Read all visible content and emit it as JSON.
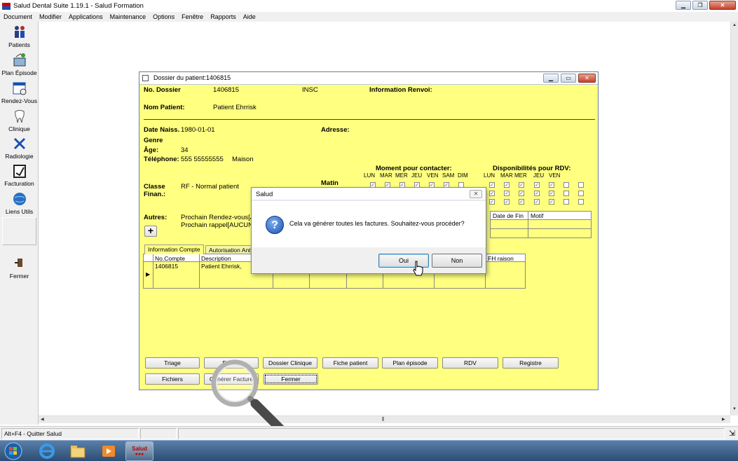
{
  "app": {
    "title": "Salud Dental Suite 1.19.1 - Salud Formation",
    "menu": [
      "Document",
      "Modifier",
      "Applications",
      "Maintenance",
      "Options",
      "Fenêtre",
      "Rapports",
      "Aide"
    ]
  },
  "sidebar": {
    "items": [
      {
        "label": "Patients",
        "icon": "patients-icon"
      },
      {
        "label": "Plan Épisode",
        "icon": "plan-episode-icon"
      },
      {
        "label": "Rendez-Vous",
        "icon": "calendar-icon"
      },
      {
        "label": "Clinique",
        "icon": "tooth-icon"
      },
      {
        "label": "Radiologie",
        "icon": "xray-icon"
      },
      {
        "label": "Facturation",
        "icon": "invoice-icon"
      },
      {
        "label": "Liens Utils",
        "icon": "globe-icon"
      },
      {
        "label": "Fermer",
        "icon": "exit-door-icon"
      }
    ]
  },
  "patient_window": {
    "title": "Dossier du patient:1406815",
    "labels": {
      "no_dossier": "No. Dossier",
      "insc": "INSC",
      "info_renvoi": "Information Renvoi:",
      "nom_patient": "Nom Patient:",
      "date_naiss": "Date Naiss.",
      "adresse": "Adresse:",
      "genre": "Genre",
      "age": "Âge:",
      "telephone": "Téléphone:",
      "classe": "Classe",
      "finan": "Finan.:",
      "matin": "Matin",
      "autres": "Autres:",
      "moment": "Moment pour contacter:",
      "dispo": "Disponibilités pour RDV:"
    },
    "values": {
      "no_dossier": "1406815",
      "nom_patient": "Patient Ehrrisk",
      "date_naiss": "1980-01-01",
      "age": "34",
      "telephone": "555 55555555",
      "telephone_type": "Maison",
      "classe": "RF - Normal patient",
      "prochain_rdv": "Prochain Rendez-vous[A",
      "prochain_rappel": "Prochain rappel[AUCUN"
    },
    "days_contact": [
      "LUN",
      "MAR",
      "MER",
      "JEU",
      "VEN",
      "SAM",
      "DIM"
    ],
    "days_rdv": [
      "LUN",
      "MAR",
      "MER",
      "JEU",
      "VEN"
    ],
    "recall_table": {
      "columns": [
        "Date de Fin",
        "Motif"
      ]
    },
    "tabs": [
      "Information Compte",
      "Autorisation Ant"
    ],
    "account_grid": {
      "columns": [
        "No.Compte",
        "Description"
      ],
      "extra_column": "FH raison",
      "rows": [
        {
          "no_compte": "1406815",
          "description": "Patient Ehrrisk,"
        }
      ]
    },
    "buttons_row1": [
      "Triage",
      "Dossier Dentaire",
      "Dossier Clinique",
      "Fiche patient",
      "Plan épisode",
      "RDV",
      "Registre"
    ],
    "buttons_row1_display": [
      "Triage",
      "Dos      er",
      "Dossier Clinique",
      "Fiche patient",
      "Plan épisode",
      "RDV",
      "Registre"
    ],
    "buttons_row2": [
      "Fichiers",
      "Générer Facture",
      "Fermer"
    ]
  },
  "dialog": {
    "title": "Salud",
    "message": "Cela va générer toutes les factures. Souhaitez-vous procéder?",
    "yes": "Oui",
    "no": "Non"
  },
  "statusbar": {
    "hint": "Alt+F4 - Quitter Salud"
  },
  "taskbar": {
    "active_app": "Salud"
  },
  "colors": {
    "form_bg": "#ffff80",
    "accent_blue": "#1a4fb0",
    "close_red": "#c3432c"
  }
}
